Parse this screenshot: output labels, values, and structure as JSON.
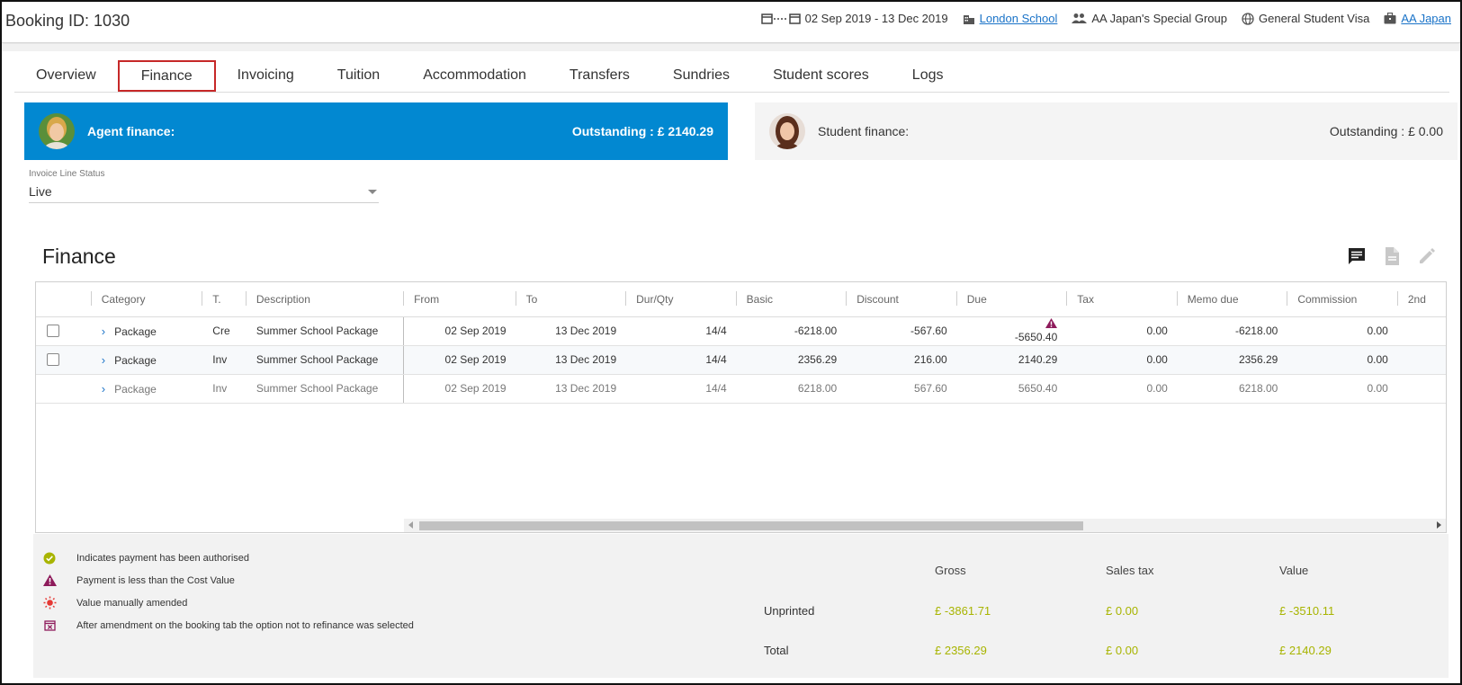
{
  "header": {
    "booking_id": "Booking ID: 1030",
    "date_range": "02 Sep 2019 - 13 Dec 2019",
    "school": "London School",
    "group": "AA Japan's Special Group",
    "visa": "General Student Visa",
    "agent": "AA Japan"
  },
  "tabs": [
    {
      "label": "Overview"
    },
    {
      "label": "Finance"
    },
    {
      "label": "Invoicing"
    },
    {
      "label": "Tuition"
    },
    {
      "label": "Accommodation"
    },
    {
      "label": "Transfers"
    },
    {
      "label": "Sundries"
    },
    {
      "label": "Student scores"
    },
    {
      "label": "Logs"
    }
  ],
  "active_tab": "Finance",
  "agent_finance": {
    "title": "Agent finance:",
    "outstanding": "Outstanding : £ 2140.29",
    "color": "#0288d1"
  },
  "student_finance": {
    "title": "Student finance:",
    "outstanding": "Outstanding : £ 0.00"
  },
  "invoice_line_status": {
    "label": "Invoice Line Status",
    "value": "Live"
  },
  "section_title": "Finance",
  "table": {
    "columns": [
      "Category",
      "T.",
      "Description",
      "From",
      "To",
      "Dur/Qty",
      "Basic",
      "Discount",
      "Due",
      "Tax",
      "Memo due",
      "Commission",
      "2nd"
    ],
    "rows": [
      {
        "category": "Package",
        "type": "Cre",
        "description": "Summer School Package",
        "from": "02 Sep 2019",
        "to": "13 Dec 2019",
        "dur": "14/4",
        "basic": "-6218.00",
        "discount": "-567.60",
        "due": "-5650.40",
        "tax": "0.00",
        "memo_due": "-6218.00",
        "commission": "0.00"
      },
      {
        "category": "Package",
        "type": "Inv",
        "description": "Summer School Package",
        "from": "02 Sep 2019",
        "to": "13 Dec 2019",
        "dur": "14/4",
        "basic": "2356.29",
        "discount": "216.00",
        "due": "2140.29",
        "tax": "0.00",
        "memo_due": "2356.29",
        "commission": "0.00"
      },
      {
        "category": "Package",
        "type": "Inv",
        "description": "Summer School Package",
        "from": "02 Sep 2019",
        "to": "13 Dec 2019",
        "dur": "14/4",
        "basic": "6218.00",
        "discount": "567.60",
        "due": "5650.40",
        "tax": "0.00",
        "memo_due": "6218.00",
        "commission": "0.00"
      }
    ]
  },
  "legend": [
    {
      "icon": "check-circle-icon",
      "color": "#a8b400",
      "text": "Indicates payment has been authorised"
    },
    {
      "icon": "warning-triangle-icon",
      "color": "#8e1b5b",
      "text": "Payment is less than the Cost Value"
    },
    {
      "icon": "sun-icon",
      "color": "#e53935",
      "text": "Value manually amended"
    },
    {
      "icon": "calendar-x-icon",
      "color": "#8e1b5b",
      "text": "After amendment on the booking tab the option not to refinance was selected"
    }
  ],
  "totals": {
    "headers": [
      "Gross",
      "Sales tax",
      "Value"
    ],
    "unprinted": {
      "label": "Unprinted",
      "gross": "£ -3861.71",
      "sales_tax": "£ 0.00",
      "value": "£ -3510.11"
    },
    "total": {
      "label": "Total",
      "gross": "£ 2356.29",
      "sales_tax": "£ 0.00",
      "value": "£ 2140.29"
    },
    "value_color": "#a8b400"
  }
}
